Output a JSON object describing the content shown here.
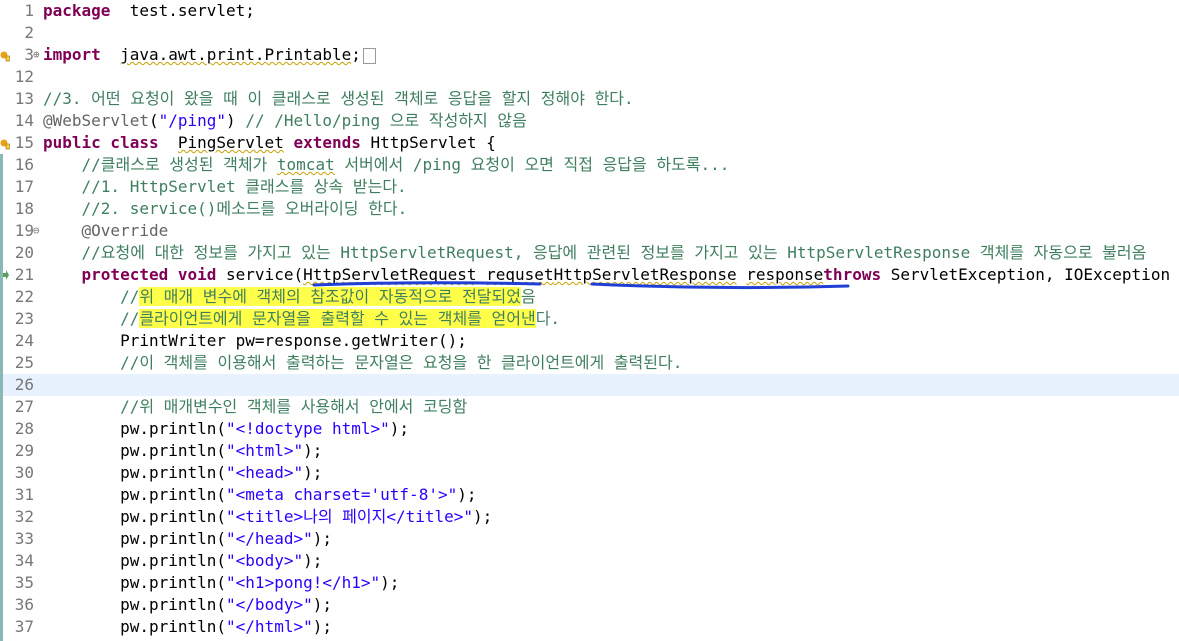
{
  "editor": {
    "lines": [
      {
        "num": "1",
        "parts": [
          [
            "kw",
            "package"
          ],
          [
            "",
            "  test.servlet;"
          ]
        ]
      },
      {
        "num": "2",
        "parts": []
      },
      {
        "num": "3",
        "parts": [
          [
            "kw",
            "import"
          ],
          [
            "",
            "  "
          ],
          [
            "sq",
            "java.awt.print.Printable"
          ],
          [
            "",
            ";"
          ]
        ],
        "fold": "⊕",
        "warn": true,
        "collapsed": true
      },
      {
        "num": "12",
        "parts": []
      },
      {
        "num": "13",
        "parts": [
          [
            "cm",
            "//3. 어떤 요청이 왔을 때 이 클래스로 생성된 객체로 응답을 할지 정해야 한다."
          ]
        ]
      },
      {
        "num": "14",
        "parts": [
          [
            "ann",
            "@WebServlet"
          ],
          [
            "",
            "("
          ],
          [
            "str",
            "\"/ping\""
          ],
          [
            "",
            ") "
          ],
          [
            "cm",
            "// /Hello/ping 으로 작성하지 않음"
          ]
        ]
      },
      {
        "num": "15",
        "parts": [
          [
            "kw",
            "public class"
          ],
          [
            "",
            "  "
          ],
          [
            "sq",
            "PingServlet"
          ],
          [
            "",
            " "
          ],
          [
            "kw",
            "extends"
          ],
          [
            "",
            " HttpServlet {"
          ]
        ],
        "warn": true
      },
      {
        "num": "16",
        "parts": [
          [
            "",
            "    "
          ],
          [
            "cm",
            "//클래스로 생성된 객체가 "
          ],
          [
            "cm sq",
            "tomcat"
          ],
          [
            "cm",
            " 서버에서 /ping 요청이 오면 직접 응답을 하도록..."
          ]
        ]
      },
      {
        "num": "17",
        "parts": [
          [
            "",
            "    "
          ],
          [
            "cm",
            "//1. HttpServlet 클래스를 상속 받는다."
          ]
        ]
      },
      {
        "num": "18",
        "parts": [
          [
            "",
            "    "
          ],
          [
            "cm",
            "//2. service()메소드를 오버라이딩 한다."
          ]
        ]
      },
      {
        "num": "19",
        "parts": [
          [
            "",
            "    "
          ],
          [
            "ann",
            "@Override"
          ]
        ],
        "fold": "⊖"
      },
      {
        "num": "20",
        "parts": [
          [
            "",
            "    "
          ],
          [
            "cm",
            "//요청에 대한 정보를 가지고 있는 HttpServletRequest, 응답에 관련된 정보를 가지고 있는 HttpServletResponse 객체를 자동으로 불러옴"
          ]
        ]
      },
      {
        "num": "21",
        "parts": [
          [
            "",
            "    "
          ],
          [
            "kw",
            "protected void"
          ],
          [
            "",
            " service("
          ],
          [
            "sq",
            "HttpServletRequest"
          ],
          [
            "",
            " "
          ],
          [
            "sq",
            "requset"
          ],
          [
            ", "
          ],
          [
            "sq",
            "HttpServletResponse"
          ],
          [
            "",
            " "
          ],
          [
            "sq",
            "response"
          ],
          [
            ") "
          ],
          [
            "kw",
            "throws"
          ],
          [
            "",
            " ServletException, IOException {"
          ]
        ],
        "arrow": true
      },
      {
        "num": "22",
        "parts": [
          [
            "",
            "        "
          ],
          [
            "cm",
            "//"
          ],
          [
            "cm hl",
            "위 매개 변수에 객체의 참조값이 자동적으로 전달되었"
          ],
          [
            "cm",
            "음"
          ]
        ]
      },
      {
        "num": "23",
        "parts": [
          [
            "",
            "        "
          ],
          [
            "cm",
            "//"
          ],
          [
            "cm hl",
            "클라이언트에게 문자열을 출력할 수 있는 객체를 얻어낸"
          ],
          [
            "cm",
            "다."
          ]
        ]
      },
      {
        "num": "24",
        "parts": [
          [
            "",
            "        PrintWriter pw=response.getWriter();"
          ]
        ]
      },
      {
        "num": "25",
        "parts": [
          [
            "",
            "        "
          ],
          [
            "cm",
            "//이 객체를 이용해서 출력하는 문자열은 요청을 한 클라이언트에게 출력된다."
          ]
        ]
      },
      {
        "num": "26",
        "parts": [],
        "current": true
      },
      {
        "num": "27",
        "parts": [
          [
            "",
            "        "
          ],
          [
            "cm",
            "//위 매개변수인 객체를 사용해서 안에서 코딩함"
          ]
        ]
      },
      {
        "num": "28",
        "parts": [
          [
            "",
            "        pw.println("
          ],
          [
            "str",
            "\"<!doctype html>\""
          ],
          [
            "",
            ");"
          ]
        ]
      },
      {
        "num": "29",
        "parts": [
          [
            "",
            "        pw.println("
          ],
          [
            "str",
            "\"<html>\""
          ],
          [
            "",
            ");"
          ]
        ]
      },
      {
        "num": "30",
        "parts": [
          [
            "",
            "        pw.println("
          ],
          [
            "str",
            "\"<head>\""
          ],
          [
            "",
            ");"
          ]
        ]
      },
      {
        "num": "31",
        "parts": [
          [
            "",
            "        pw.println("
          ],
          [
            "str",
            "\"<meta charset='utf-8'>\""
          ],
          [
            "",
            ");"
          ]
        ]
      },
      {
        "num": "32",
        "parts": [
          [
            "",
            "        pw.println("
          ],
          [
            "str",
            "\"<title>나의 페이지</title>\""
          ],
          [
            "",
            ");"
          ]
        ]
      },
      {
        "num": "33",
        "parts": [
          [
            "",
            "        pw.println("
          ],
          [
            "str",
            "\"</head>\""
          ],
          [
            "",
            ");"
          ]
        ]
      },
      {
        "num": "34",
        "parts": [
          [
            "",
            "        pw.println("
          ],
          [
            "str",
            "\"<body>\""
          ],
          [
            "",
            ");"
          ]
        ]
      },
      {
        "num": "35",
        "parts": [
          [
            "",
            "        pw.println("
          ],
          [
            "str",
            "\"<h1>pong!</h1>\""
          ],
          [
            "",
            ");"
          ]
        ]
      },
      {
        "num": "36",
        "parts": [
          [
            "",
            "        pw.println("
          ],
          [
            "str",
            "\"</body>\""
          ],
          [
            "",
            ");"
          ]
        ]
      },
      {
        "num": "37",
        "parts": [
          [
            "",
            "        pw.println("
          ],
          [
            "str",
            "\"</html>\""
          ],
          [
            "",
            ");"
          ]
        ]
      }
    ]
  },
  "colors": {
    "keyword": "#7f0055",
    "comment": "#3f7f5f",
    "string": "#2a00ff",
    "annotation": "#646464",
    "highlight": "#ffff4a",
    "ink": "#1f3fd6",
    "current_line": "#e8f2fe"
  }
}
